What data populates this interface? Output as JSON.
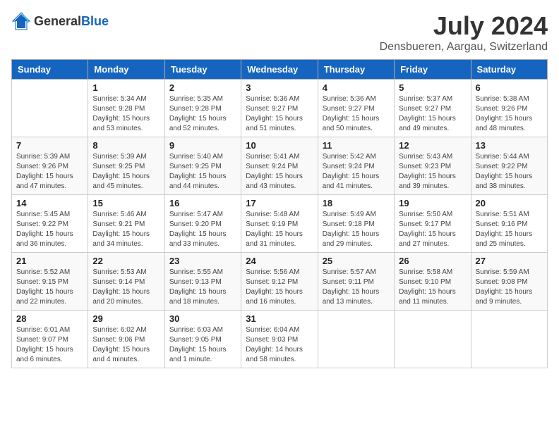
{
  "logo": {
    "general": "General",
    "blue": "Blue"
  },
  "title": {
    "month_year": "July 2024",
    "location": "Densbueren, Aargau, Switzerland"
  },
  "weekdays": [
    "Sunday",
    "Monday",
    "Tuesday",
    "Wednesday",
    "Thursday",
    "Friday",
    "Saturday"
  ],
  "weeks": [
    [
      {
        "day": "",
        "sunrise": "",
        "sunset": "",
        "daylight": ""
      },
      {
        "day": "1",
        "sunrise": "Sunrise: 5:34 AM",
        "sunset": "Sunset: 9:28 PM",
        "daylight": "Daylight: 15 hours and 53 minutes."
      },
      {
        "day": "2",
        "sunrise": "Sunrise: 5:35 AM",
        "sunset": "Sunset: 9:28 PM",
        "daylight": "Daylight: 15 hours and 52 minutes."
      },
      {
        "day": "3",
        "sunrise": "Sunrise: 5:36 AM",
        "sunset": "Sunset: 9:27 PM",
        "daylight": "Daylight: 15 hours and 51 minutes."
      },
      {
        "day": "4",
        "sunrise": "Sunrise: 5:36 AM",
        "sunset": "Sunset: 9:27 PM",
        "daylight": "Daylight: 15 hours and 50 minutes."
      },
      {
        "day": "5",
        "sunrise": "Sunrise: 5:37 AM",
        "sunset": "Sunset: 9:27 PM",
        "daylight": "Daylight: 15 hours and 49 minutes."
      },
      {
        "day": "6",
        "sunrise": "Sunrise: 5:38 AM",
        "sunset": "Sunset: 9:26 PM",
        "daylight": "Daylight: 15 hours and 48 minutes."
      }
    ],
    [
      {
        "day": "7",
        "sunrise": "Sunrise: 5:39 AM",
        "sunset": "Sunset: 9:26 PM",
        "daylight": "Daylight: 15 hours and 47 minutes."
      },
      {
        "day": "8",
        "sunrise": "Sunrise: 5:39 AM",
        "sunset": "Sunset: 9:25 PM",
        "daylight": "Daylight: 15 hours and 45 minutes."
      },
      {
        "day": "9",
        "sunrise": "Sunrise: 5:40 AM",
        "sunset": "Sunset: 9:25 PM",
        "daylight": "Daylight: 15 hours and 44 minutes."
      },
      {
        "day": "10",
        "sunrise": "Sunrise: 5:41 AM",
        "sunset": "Sunset: 9:24 PM",
        "daylight": "Daylight: 15 hours and 43 minutes."
      },
      {
        "day": "11",
        "sunrise": "Sunrise: 5:42 AM",
        "sunset": "Sunset: 9:24 PM",
        "daylight": "Daylight: 15 hours and 41 minutes."
      },
      {
        "day": "12",
        "sunrise": "Sunrise: 5:43 AM",
        "sunset": "Sunset: 9:23 PM",
        "daylight": "Daylight: 15 hours and 39 minutes."
      },
      {
        "day": "13",
        "sunrise": "Sunrise: 5:44 AM",
        "sunset": "Sunset: 9:22 PM",
        "daylight": "Daylight: 15 hours and 38 minutes."
      }
    ],
    [
      {
        "day": "14",
        "sunrise": "Sunrise: 5:45 AM",
        "sunset": "Sunset: 9:22 PM",
        "daylight": "Daylight: 15 hours and 36 minutes."
      },
      {
        "day": "15",
        "sunrise": "Sunrise: 5:46 AM",
        "sunset": "Sunset: 9:21 PM",
        "daylight": "Daylight: 15 hours and 34 minutes."
      },
      {
        "day": "16",
        "sunrise": "Sunrise: 5:47 AM",
        "sunset": "Sunset: 9:20 PM",
        "daylight": "Daylight: 15 hours and 33 minutes."
      },
      {
        "day": "17",
        "sunrise": "Sunrise: 5:48 AM",
        "sunset": "Sunset: 9:19 PM",
        "daylight": "Daylight: 15 hours and 31 minutes."
      },
      {
        "day": "18",
        "sunrise": "Sunrise: 5:49 AM",
        "sunset": "Sunset: 9:18 PM",
        "daylight": "Daylight: 15 hours and 29 minutes."
      },
      {
        "day": "19",
        "sunrise": "Sunrise: 5:50 AM",
        "sunset": "Sunset: 9:17 PM",
        "daylight": "Daylight: 15 hours and 27 minutes."
      },
      {
        "day": "20",
        "sunrise": "Sunrise: 5:51 AM",
        "sunset": "Sunset: 9:16 PM",
        "daylight": "Daylight: 15 hours and 25 minutes."
      }
    ],
    [
      {
        "day": "21",
        "sunrise": "Sunrise: 5:52 AM",
        "sunset": "Sunset: 9:15 PM",
        "daylight": "Daylight: 15 hours and 22 minutes."
      },
      {
        "day": "22",
        "sunrise": "Sunrise: 5:53 AM",
        "sunset": "Sunset: 9:14 PM",
        "daylight": "Daylight: 15 hours and 20 minutes."
      },
      {
        "day": "23",
        "sunrise": "Sunrise: 5:55 AM",
        "sunset": "Sunset: 9:13 PM",
        "daylight": "Daylight: 15 hours and 18 minutes."
      },
      {
        "day": "24",
        "sunrise": "Sunrise: 5:56 AM",
        "sunset": "Sunset: 9:12 PM",
        "daylight": "Daylight: 15 hours and 16 minutes."
      },
      {
        "day": "25",
        "sunrise": "Sunrise: 5:57 AM",
        "sunset": "Sunset: 9:11 PM",
        "daylight": "Daylight: 15 hours and 13 minutes."
      },
      {
        "day": "26",
        "sunrise": "Sunrise: 5:58 AM",
        "sunset": "Sunset: 9:10 PM",
        "daylight": "Daylight: 15 hours and 11 minutes."
      },
      {
        "day": "27",
        "sunrise": "Sunrise: 5:59 AM",
        "sunset": "Sunset: 9:08 PM",
        "daylight": "Daylight: 15 hours and 9 minutes."
      }
    ],
    [
      {
        "day": "28",
        "sunrise": "Sunrise: 6:01 AM",
        "sunset": "Sunset: 9:07 PM",
        "daylight": "Daylight: 15 hours and 6 minutes."
      },
      {
        "day": "29",
        "sunrise": "Sunrise: 6:02 AM",
        "sunset": "Sunset: 9:06 PM",
        "daylight": "Daylight: 15 hours and 4 minutes."
      },
      {
        "day": "30",
        "sunrise": "Sunrise: 6:03 AM",
        "sunset": "Sunset: 9:05 PM",
        "daylight": "Daylight: 15 hours and 1 minute."
      },
      {
        "day": "31",
        "sunrise": "Sunrise: 6:04 AM",
        "sunset": "Sunset: 9:03 PM",
        "daylight": "Daylight: 14 hours and 58 minutes."
      },
      {
        "day": "",
        "sunrise": "",
        "sunset": "",
        "daylight": ""
      },
      {
        "day": "",
        "sunrise": "",
        "sunset": "",
        "daylight": ""
      },
      {
        "day": "",
        "sunrise": "",
        "sunset": "",
        "daylight": ""
      }
    ]
  ]
}
